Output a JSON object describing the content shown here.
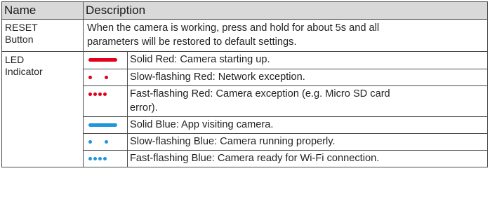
{
  "colors": {
    "red": "#e2001a",
    "blue": "#1f96dc"
  },
  "header": {
    "name": "Name",
    "description": "Description"
  },
  "reset": {
    "name_line1": "RESET",
    "name_line2": "Button",
    "description_line1": "When the camera is working, press and hold for about 5s and all",
    "description_line2": "parameters will be restored to default settings."
  },
  "led": {
    "name_line1": "LED",
    "name_line2": "Indicator",
    "rows": [
      {
        "pattern": "solid",
        "color": "red",
        "text": "Solid Red: Camera starting up."
      },
      {
        "pattern": "slow",
        "color": "red",
        "text": "Slow-flashing Red: Network exception."
      },
      {
        "pattern": "fast",
        "color": "red",
        "text_line1": "Fast-flashing Red: Camera exception (e.g. Micro SD card",
        "text_line2": "error)."
      },
      {
        "pattern": "solid",
        "color": "blue",
        "text": "Solid Blue: App visiting camera."
      },
      {
        "pattern": "slow",
        "color": "blue",
        "text": "Slow-flashing Blue: Camera running properly."
      },
      {
        "pattern": "fast",
        "color": "blue",
        "text": "Fast-flashing Blue: Camera ready for Wi-Fi connection."
      }
    ]
  }
}
